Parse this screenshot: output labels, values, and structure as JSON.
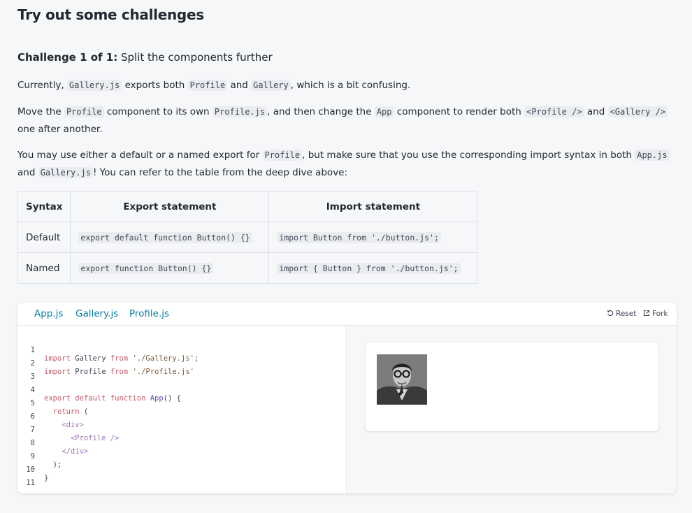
{
  "heading": "Try out some challenges",
  "challenge": {
    "label": "Challenge 1 of 1:",
    "title": "Split the components further"
  },
  "p1": {
    "t1": "Currently, ",
    "c1": "Gallery.js",
    "t2": " exports both ",
    "c2": "Profile",
    "t3": " and ",
    "c3": "Gallery",
    "t4": ", which is a bit confusing."
  },
  "p2": {
    "t1": "Move the ",
    "c1": "Profile",
    "t2": " component to its own ",
    "c2": "Profile.js",
    "t3": ", and then change the ",
    "c3": "App",
    "t4": " component to render both ",
    "c4": "<Profile />",
    "t5": " and ",
    "c5": "<Gallery />",
    "t6": " one after another."
  },
  "p3": {
    "t1": "You may use either a default or a named export for ",
    "c1": "Profile",
    "t2": ", but make sure that you use the corresponding import syntax in both ",
    "c2": "App.js",
    "t3": " and ",
    "c3": "Gallery.js",
    "t4": "! You can refer to the table from the deep dive above:"
  },
  "table": {
    "headers": [
      "Syntax",
      "Export statement",
      "Import statement"
    ],
    "rows": [
      [
        "Default",
        "export default function Button() {}",
        "import Button from './button.js';"
      ],
      [
        "Named",
        "export function Button() {}",
        "import { Button } from './button.js';"
      ]
    ]
  },
  "sandbox": {
    "tabs": [
      "App.js",
      "Gallery.js",
      "Profile.js"
    ],
    "reset_label": "Reset",
    "fork_label": "Fork",
    "line_numbers": [
      "1",
      "2",
      "3",
      "4",
      "5",
      "6",
      "7",
      "8",
      "9",
      "10",
      "11"
    ],
    "code": [
      {
        "kw": "import",
        "t": " Gallery ",
        "kw2": "from",
        "s": " './Gallery.js';"
      },
      {
        "kw": "import",
        "t": " Profile ",
        "kw2": "from",
        "s": " './Profile.js'"
      },
      {
        "raw": ""
      },
      {
        "kw": "export default function",
        "fn": " App",
        "t": "() {"
      },
      {
        "kw": "  return",
        "t": " ("
      },
      {
        "tag": "    <div>"
      },
      {
        "tag": "      <Profile />"
      },
      {
        "tag": "    </div>"
      },
      {
        "t": "  );"
      },
      {
        "t": "}"
      },
      {
        "raw": ""
      }
    ]
  },
  "icons": {
    "reset": "reset-icon",
    "fork": "fork-icon",
    "portrait": "profile-photo"
  }
}
